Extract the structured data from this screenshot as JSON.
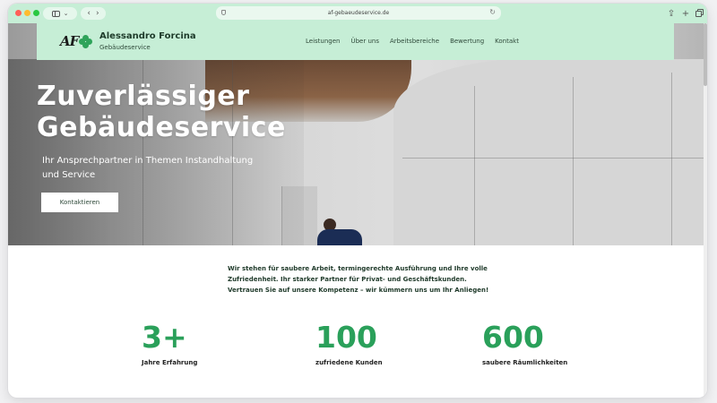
{
  "browser": {
    "url": "af-gebaeudeservice.de",
    "icons": [
      "sidebar-icon",
      "chevron-down-icon",
      "back-icon",
      "forward-icon",
      "shield-icon",
      "reload-icon",
      "share-icon",
      "plus-icon",
      "tabs-icon"
    ]
  },
  "header": {
    "logo_text": "AF",
    "brand_name": "Alessandro Forcina",
    "brand_sub": "Gebäudeservice",
    "nav": [
      "Leistungen",
      "Über uns",
      "Arbeitsbereiche",
      "Bewertung",
      "Kontakt"
    ],
    "colors": {
      "header_bg": "#c6eed6",
      "accent": "#2aa05a"
    }
  },
  "hero": {
    "title_line1": "Zuverlässiger",
    "title_line2": "Gebäudeservice",
    "subtitle": "Ihr Ansprechpartner in Themen Instandhaltung und Service",
    "cta_label": "Kontaktieren"
  },
  "intro": {
    "text": "Wir stehen für saubere Arbeit, termingerechte Ausführung und Ihre volle Zufriedenheit. Ihr starker Partner für Privat- und Geschäftskunden. Vertrauen Sie auf unsere Kompetenz – wir kümmern uns um Ihr Anliegen!"
  },
  "stats": [
    {
      "value": "3+",
      "label": "Jahre Erfahrung"
    },
    {
      "value": "100",
      "label": "zufriedene Kunden"
    },
    {
      "value": "600",
      "label": "saubere Räumlichkeiten"
    }
  ]
}
